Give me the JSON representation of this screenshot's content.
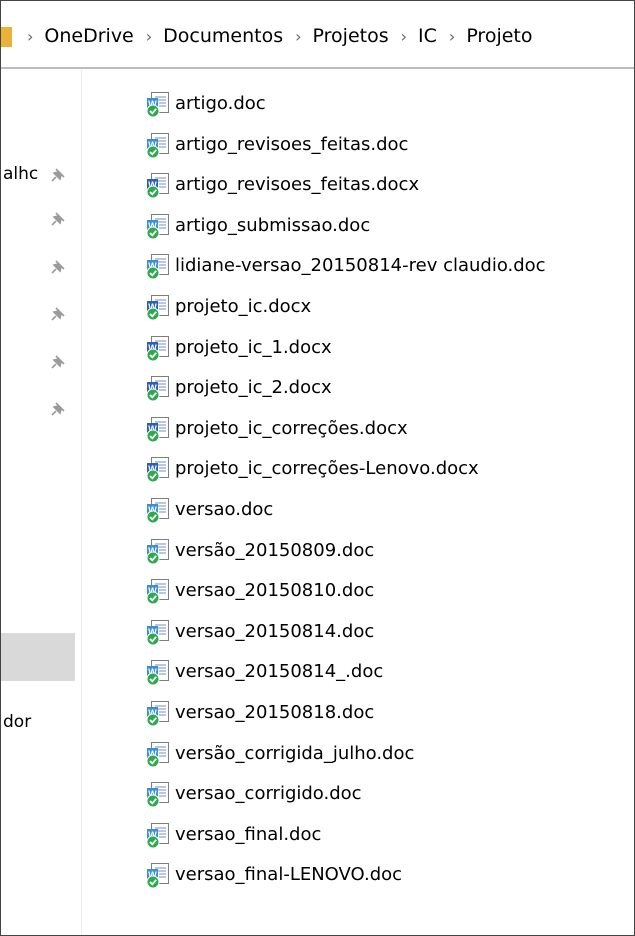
{
  "address_bar": {
    "breadcrumbs": [
      "OneDrive",
      "Documentos",
      "Projetos",
      "IC",
      "Projeto"
    ],
    "separator": "›"
  },
  "nav_pane": {
    "partial_label_top": "alhc",
    "partial_label_bottom": "dor",
    "pinned_count": 6
  },
  "files": [
    {
      "name": "artigo.doc",
      "icon": "word-doc-icon"
    },
    {
      "name": "artigo_revisoes_feitas.doc",
      "icon": "word-doc-icon"
    },
    {
      "name": "artigo_revisoes_feitas.docx",
      "icon": "word-docx-icon"
    },
    {
      "name": "artigo_submissao.doc",
      "icon": "word-doc-icon"
    },
    {
      "name": "lidiane-versao_20150814-rev claudio.doc",
      "icon": "word-doc-icon"
    },
    {
      "name": "projeto_ic.docx",
      "icon": "word-docx-icon"
    },
    {
      "name": "projeto_ic_1.docx",
      "icon": "word-docx-icon"
    },
    {
      "name": "projeto_ic_2.docx",
      "icon": "word-docx-icon"
    },
    {
      "name": "projeto_ic_correções.docx",
      "icon": "word-docx-icon"
    },
    {
      "name": "projeto_ic_correções-Lenovo.docx",
      "icon": "word-docx-icon"
    },
    {
      "name": "versao.doc",
      "icon": "word-doc-icon"
    },
    {
      "name": "versão_20150809.doc",
      "icon": "word-doc-icon"
    },
    {
      "name": "versao_20150810.doc",
      "icon": "word-doc-icon"
    },
    {
      "name": "versao_20150814.doc",
      "icon": "word-doc-icon"
    },
    {
      "name": "versao_20150814_.doc",
      "icon": "word-doc-icon"
    },
    {
      "name": "versao_20150818.doc",
      "icon": "word-doc-icon"
    },
    {
      "name": "versão_corrigida_julho.doc",
      "icon": "word-doc-icon"
    },
    {
      "name": "versao_corrigido.doc",
      "icon": "word-doc-icon"
    },
    {
      "name": "versao_final.doc",
      "icon": "word-doc-icon"
    },
    {
      "name": "versao_final-LENOVO.doc",
      "icon": "word-doc-icon"
    }
  ],
  "colors": {
    "sync_check": "#2fa84f",
    "docx_badge": "#2b5fb8",
    "doc_badge": "#3a8fd6",
    "selection": "#d9d9d9",
    "folder": "#e9b33a"
  }
}
